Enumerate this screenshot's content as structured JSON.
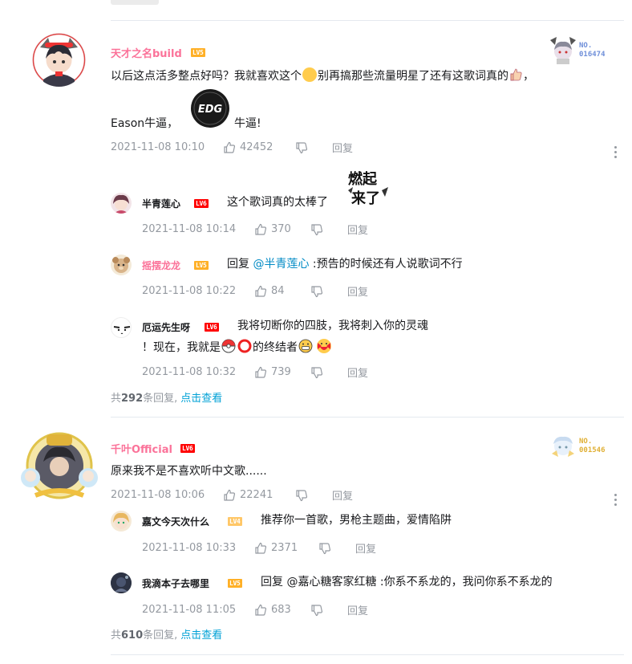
{
  "comments": [
    {
      "username": "天才之名build",
      "level": "LV5",
      "badge_no": "NO.\n016474",
      "text_line1_a": "以后这点活多整点好吗？我就喜欢这个",
      "text_line1_b": "别再搞那些流量明星了还有这歌词真的",
      "text_line1_c": "，",
      "text_line2_a": "Eason牛逼，",
      "text_line2_b": "牛逼!",
      "sticker_label": "EDG",
      "time": "2021-11-08 10:10",
      "likes": "42452",
      "reply_label": "回复",
      "replies": [
        {
          "username": "半青莲心",
          "level": "LV6",
          "text": "这个歌词真的太棒了",
          "sticker_label": "燃起来了",
          "time": "2021-11-08 10:14",
          "likes": "370",
          "reply_label": "回复"
        },
        {
          "username": "摇摆龙龙",
          "level": "LV5",
          "text_prefix": "回复 ",
          "mention": "@半青莲心",
          "text_suffix": " :预告的时候还有人说歌词不行",
          "time": "2021-11-08 10:22",
          "likes": "84",
          "reply_label": "回复"
        },
        {
          "username": "厄运先生呀",
          "level": "LV6",
          "text_line1": "我将切断你的四肢，我将刺入你的灵魂",
          "text_line2_a": "！现在，我就是",
          "text_line2_b": "的终结者",
          "time": "2021-11-08 10:32",
          "likes": "739",
          "reply_label": "回复"
        }
      ],
      "reply_count_prefix": "共",
      "reply_count": "292",
      "reply_count_suffix": "条回复,",
      "view_more": "点击查看"
    },
    {
      "username": "千叶Official",
      "level": "LV6",
      "badge_no": "NO.\n001546",
      "text": "原来我不是不喜欢听中文歌......",
      "time": "2021-11-08 10:06",
      "likes": "22241",
      "reply_label": "回复",
      "replies": [
        {
          "username": "嘉文今天次什么",
          "level": "LV4",
          "text": "推荐你一首歌，男枪主题曲，爱情陷阱",
          "time": "2021-11-08 10:33",
          "likes": "2371",
          "reply_label": "回复"
        },
        {
          "username": "我滴本子去哪里",
          "level": "LV5",
          "text": "回复 @嘉心糖客家红糖 :你系不系龙的，我问你系不系龙的",
          "time": "2021-11-08 11:05",
          "likes": "683",
          "reply_label": "回复"
        }
      ],
      "reply_count_prefix": "共",
      "reply_count": "610",
      "reply_count_suffix": "条回复,",
      "view_more": "点击查看"
    }
  ],
  "colors": {
    "pink_username": "#fb7299",
    "link_blue": "#00a1d6",
    "mention_blue": "#008ac5",
    "meta_gray": "#9499a0",
    "lv5": "#ffb027",
    "lv6": "#ff0000"
  }
}
